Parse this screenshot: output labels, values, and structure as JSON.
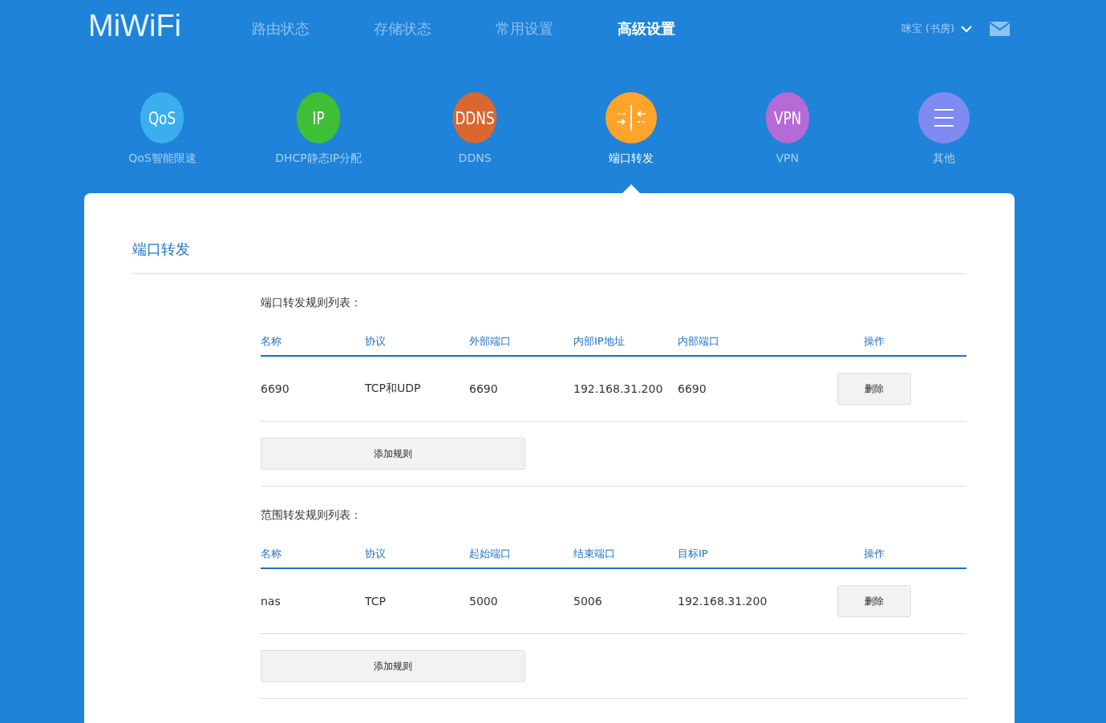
{
  "header": {
    "logo": "MiWiFi",
    "nav": [
      {
        "label": "路由状态",
        "selected": false
      },
      {
        "label": "存储状态",
        "selected": false
      },
      {
        "label": "常用设置",
        "selected": false
      },
      {
        "label": "高级设置",
        "selected": true
      }
    ],
    "user": "咪宝 (书房)"
  },
  "features": [
    {
      "kind": "text",
      "glyph": "QoS",
      "label": "QoS智能限速",
      "color": "#3aaeee",
      "selected": false
    },
    {
      "kind": "text",
      "glyph": "IP",
      "label": "DHCP静态IP分配",
      "color": "#3fbf35",
      "selected": false
    },
    {
      "kind": "text",
      "glyph": "DDNS",
      "label": "DDNS",
      "color": "#d9672f",
      "selected": false
    },
    {
      "kind": "arrows",
      "label": "端口转发",
      "color": "#ffa42a",
      "selected": true
    },
    {
      "kind": "text",
      "glyph": "VPN",
      "label": "VPN",
      "color": "#b56ad6",
      "selected": false
    },
    {
      "kind": "menu",
      "label": "其他",
      "color": "#7f8bf0",
      "selected": false
    }
  ],
  "panel": {
    "title": "端口转发",
    "tables": [
      {
        "caption": "端口转发规则列表：",
        "columns": [
          "名称",
          "协议",
          "外部端口",
          "内部IP地址",
          "内部端口",
          "操作"
        ],
        "rows": [
          {
            "cells": [
              "6690",
              "TCP和UDP",
              "6690",
              "192.168.31.200",
              "6690"
            ],
            "action": "删除"
          }
        ],
        "add_button": "添加规则"
      },
      {
        "caption": "范围转发规则列表：",
        "columns": [
          "名称",
          "协议",
          "起始端口",
          "结束端口",
          "目标IP",
          "操作"
        ],
        "rows": [
          {
            "cells": [
              "nas",
              "TCP",
              "5000",
              "5006",
              "192.168.31.200"
            ],
            "action": "删除"
          }
        ],
        "add_button": "添加规则"
      }
    ]
  }
}
